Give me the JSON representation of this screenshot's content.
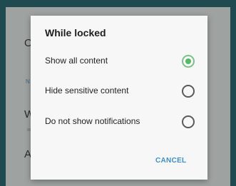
{
  "background": {
    "items": [
      {
        "label": "O"
      },
      {
        "label": "N"
      },
      {
        "label": "W"
      },
      {
        "label": "A"
      }
    ]
  },
  "dialog": {
    "title": "While locked",
    "options": [
      {
        "label": "Show all content",
        "checked": true
      },
      {
        "label": "Hide sensitive content",
        "checked": false
      },
      {
        "label": "Do not show notifications",
        "checked": false
      }
    ],
    "cancel_label": "CANCEL"
  },
  "colors": {
    "accent_green": "#54b96a",
    "button_blue": "#3f8fc2"
  }
}
